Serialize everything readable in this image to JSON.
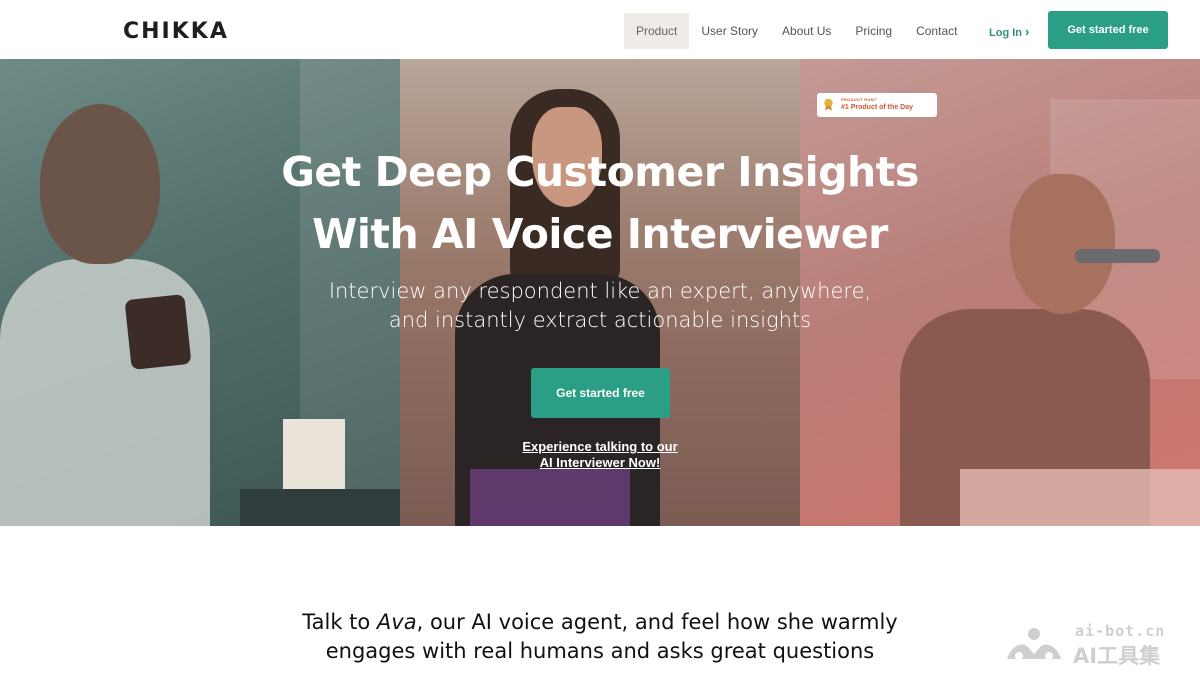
{
  "nav": {
    "logo": "CHIKKA",
    "links": [
      "Product",
      "User Story",
      "About Us",
      "Pricing",
      "Contact"
    ],
    "active_link": "Product",
    "login": "Log In",
    "cta": "Get started free"
  },
  "badge": {
    "top": "PRODUCT HUNT",
    "main": "#1 Product of the Day",
    "icon": "medal-icon"
  },
  "hero": {
    "headline_1": "Get Deep Customer Insights",
    "headline_2": "With AI Voice Interviewer",
    "sub_1": "Interview any respondent like an expert, anywhere,",
    "sub_2": "and instantly extract actionable insights",
    "cta": "Get started free",
    "demo_1": "Experience talking to our",
    "demo_2": "AI Interviewer Now!"
  },
  "talk": {
    "part_1": "Talk to ",
    "name": "Ava",
    "part_2": ", our AI voice agent, and feel how she warmly",
    "line_2": "engages with real humans and asks great questions"
  },
  "watermark": {
    "top": "ai-bot.cn",
    "bottom": "AI工具集"
  },
  "colors": {
    "accent": "#2b9f86",
    "badge_text": "#d35430"
  }
}
